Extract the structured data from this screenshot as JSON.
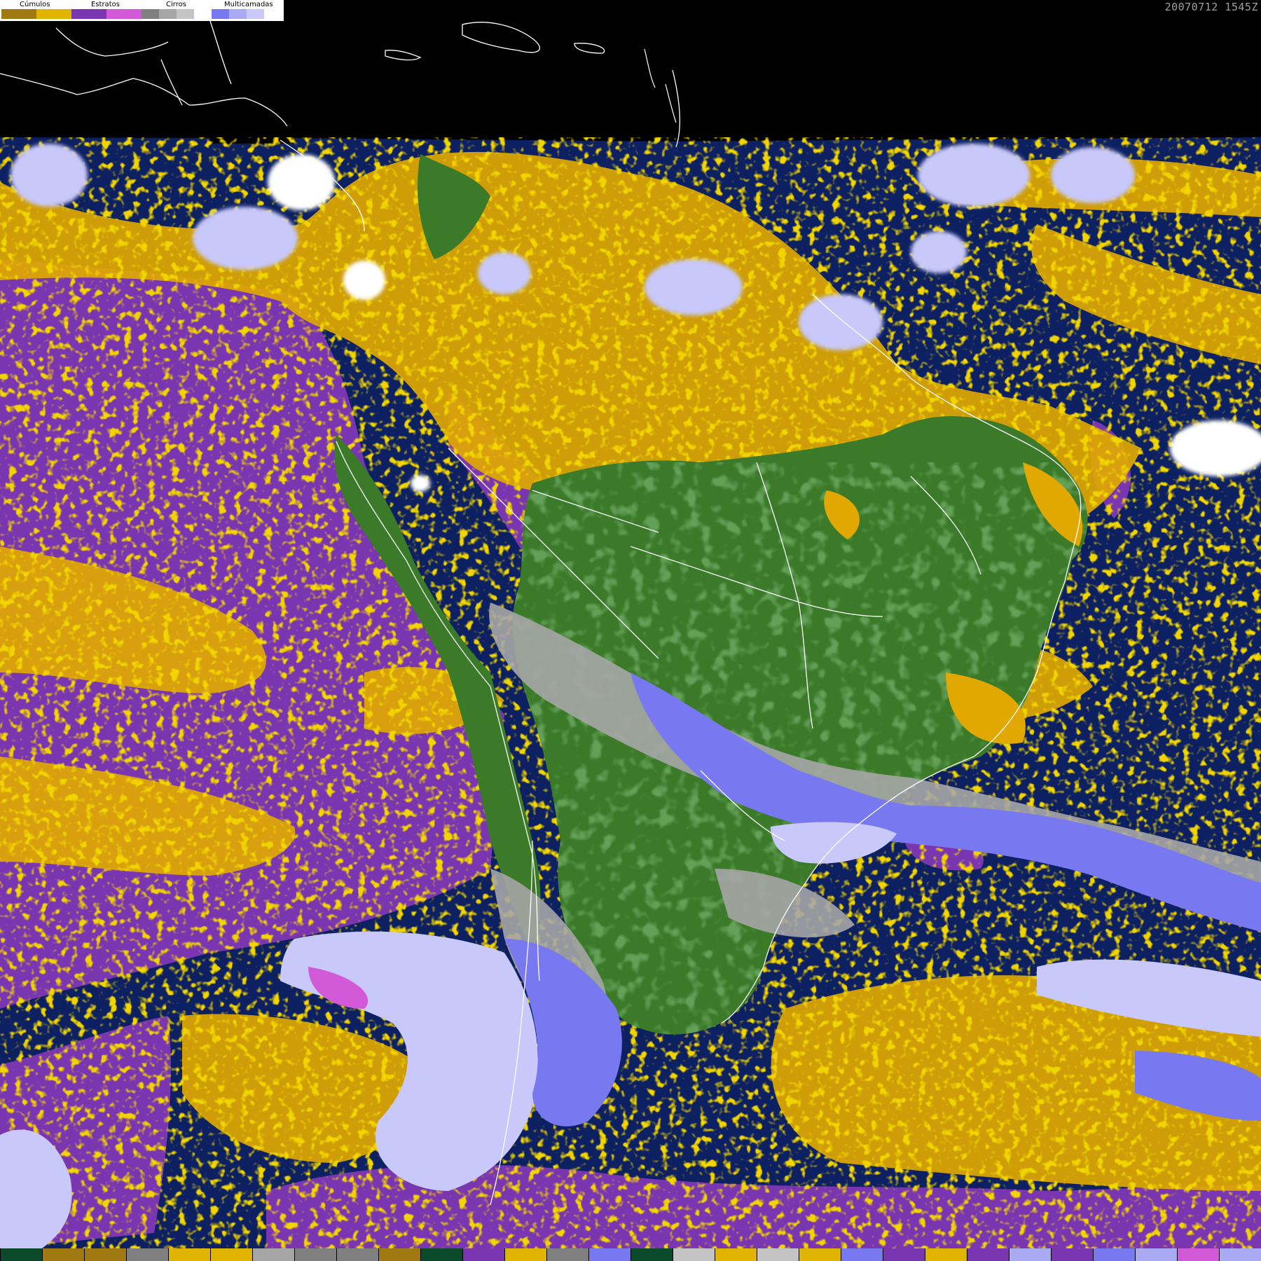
{
  "legend": {
    "groups": [
      {
        "label": "Cúmulos",
        "colors": [
          "#a07a10",
          "#e0b400"
        ]
      },
      {
        "label": "Estratos",
        "colors": [
          "#7a35b0",
          "#d25ad8"
        ]
      },
      {
        "label": "Cirros",
        "colors": [
          "#808080",
          "#a6a6a6",
          "#c4c4c4"
        ]
      },
      {
        "label": "Multicamadas",
        "colors": [
          "#7878f0",
          "#a9a9f4",
          "#c8c8fa",
          "#ffffff"
        ]
      }
    ]
  },
  "timestamp": "20070712 1545Z",
  "colors": {
    "space": "#000000",
    "ocean": "#0c2062",
    "land": "#3a7a28",
    "land_dark": "#225818",
    "cumulus": "#e0a800",
    "cumulus_dark": "#a07a10",
    "stratus": "#7a35b0",
    "stratus_light": "#d25ad8",
    "cirrus": "#a6a6a6",
    "multilayer": "#7878f0",
    "multilayer_light": "#c8c8fa",
    "coast": "#ffffff"
  },
  "bottom_bar": [
    "#0a4a2a",
    "#a07a10",
    "#a07a10",
    "#808080",
    "#e0b400",
    "#e0b400",
    "#a6a6a6",
    "#808080",
    "#808080",
    "#a07a10",
    "#0a4a2a",
    "#7a35b0",
    "#e0b400",
    "#808080",
    "#7878f0",
    "#0a4a2a",
    "#c4c4c4",
    "#e0b400",
    "#c4c4c4",
    "#e0b400",
    "#7878f0",
    "#7a35b0",
    "#e0b400",
    "#7a35b0",
    "#a9a9f4",
    "#7a35b0",
    "#7878f0",
    "#a9a9f4",
    "#d25ad8",
    "#a9a9f4"
  ]
}
